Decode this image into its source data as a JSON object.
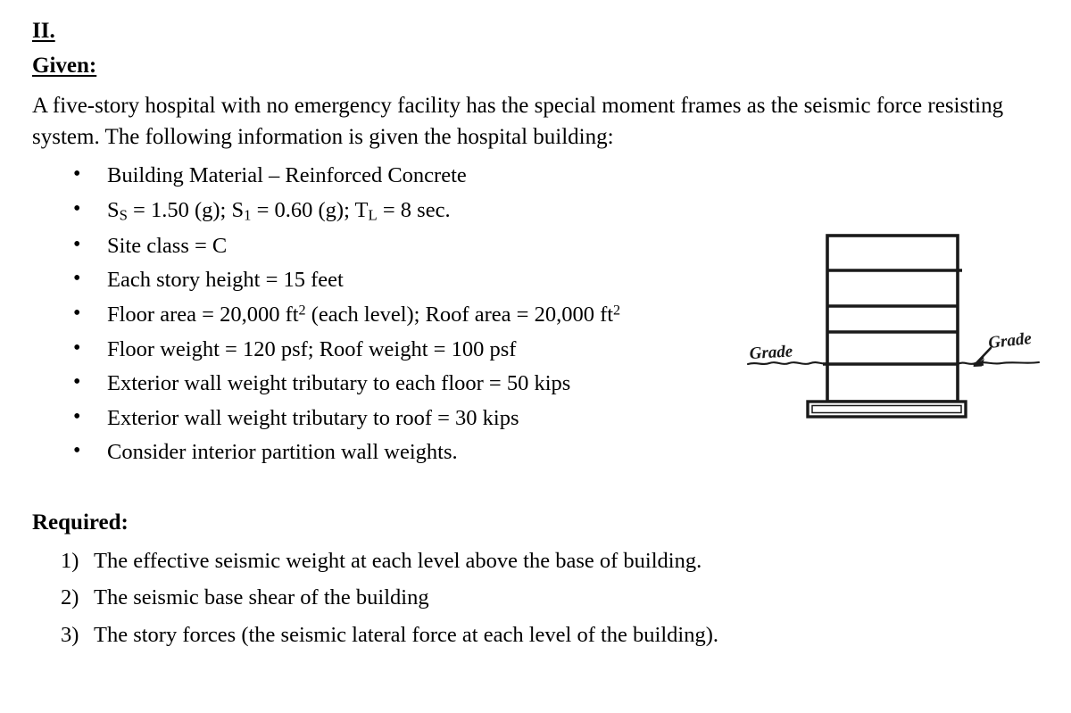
{
  "document": {
    "section_number": "II.",
    "given_heading": "Given:",
    "intro_paragraph": "A five-story hospital with no emergency facility has the special moment frames as the seismic force resisting system. The following information is given the hospital building:",
    "given_items": [
      {
        "id": "building-material",
        "text": "Building Material – Reinforced Concrete"
      },
      {
        "id": "seismic-parameters",
        "text": "Sₛ = 1.50 (g); S₁ = 0.60 (g); Tₗ = 8 sec."
      },
      {
        "id": "site-class",
        "text": "Site class = C"
      },
      {
        "id": "story-height",
        "text": "Each story height = 15 feet"
      },
      {
        "id": "floor-area",
        "text": "Floor area = 20,000 ft² (each level); Roof area = 20,000 ft²"
      },
      {
        "id": "floor-weight",
        "text": "Floor weight = 120 psf; Roof weight = 100 psf"
      },
      {
        "id": "wall-weight-floor",
        "text": "Exterior wall weight tributary to each floor = 50 kips"
      },
      {
        "id": "wall-weight-roof",
        "text": "Exterior wall weight tributary to roof = 30 kips"
      },
      {
        "id": "partition-walls",
        "text": "Consider interior partition wall weights."
      }
    ],
    "required_heading": "Required:",
    "required_items": [
      {
        "number": "1)",
        "text": "The effective seismic weight at each level above the base of building."
      },
      {
        "number": "2)",
        "text": "The seismic base shear of the building"
      },
      {
        "number": "3)",
        "text": "The story forces (the seismic lateral force at each level of the building)."
      }
    ]
  },
  "given_item_markup": [
    "Building Material – Reinforced Concrete",
    "S<sub>S</sub> = 1.50 (g); S<sub>1</sub> = 0.60 (g); T<sub>L</sub> = 8 sec.",
    "Site class = C",
    "Each story height = 15 feet",
    "Floor area = 20,000 ft<sup>2</sup> (each level); Roof area = 20,000 ft<sup>2</sup>",
    "Floor weight = 120 psf; Roof weight = 100 psf",
    "Exterior wall weight tributary to each floor = 50 kips",
    "Exterior wall weight tributary to roof = 30 kips",
    "Consider interior partition wall weights."
  ],
  "diagram": {
    "title": "five-story-building-elevation",
    "grade_label_left": "Grade",
    "grade_label_right": "Grade",
    "stories": 5,
    "line_color": "#1a1a1a",
    "fill_color": "#ffffff",
    "has_footing": true,
    "has_ground_line": true,
    "has_arrow_right": true
  },
  "colors": {
    "text": "#000000",
    "background": "#ffffff",
    "diagram_ink": "#1a1a1a"
  }
}
